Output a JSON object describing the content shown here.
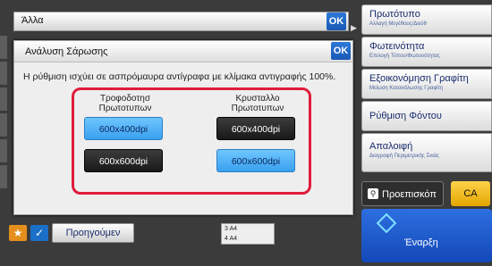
{
  "background": {
    "title": "Άλλα",
    "ok_label": "OK",
    "right_panel": [
      {
        "main": "Πρωτότυπο",
        "sub": "Αλλαγή Μεγέθους/Διεύθ"
      },
      {
        "main": "Φωτεινότητα",
        "sub": "Επιλογή Τύπου/Φωτεινότητας"
      },
      {
        "main": "Εξοικονόμηση Γραφίτη",
        "sub": "Μείωση Κατανάλωσης Γραφίτη"
      },
      {
        "main": "Ρύθμιση Φόντου",
        "sub": ""
      },
      {
        "main": "Απαλοιφή",
        "sub": "Διαγραφή Περιμετρικής Σκιάς"
      }
    ],
    "preview_label": "Προεπισκόπ",
    "ca_label": "CA",
    "start_label": "Έναρξη",
    "prev_label": "Προηγούμεν",
    "tray_rows": [
      "3      A4",
      "4      A4"
    ]
  },
  "dialog": {
    "title": "Ανάλυση Σάρωσης",
    "ok_label": "OK",
    "description": "Η ρύθμιση ισχύει σε ασπρόμαυρα αντίγραφα με κλίμακα αντιγραφής 100%.",
    "columns": [
      {
        "label_line1": "Τροφοδοτησ",
        "label_line2": "Πρωτοτυπων",
        "options": [
          {
            "label": "600x400dpi",
            "selected": true
          },
          {
            "label": "600x600dpi",
            "selected": false
          }
        ]
      },
      {
        "label_line1": "Κρυσταλλο",
        "label_line2": "Πρωτοτυπων",
        "options": [
          {
            "label": "600x400dpi",
            "selected": false
          },
          {
            "label": "600x600dpi",
            "selected": true
          }
        ]
      }
    ]
  },
  "colors": {
    "accent_blue": "#3aa0ef",
    "highlight_red": "#e01c3c",
    "ok_blue": "#1859b5",
    "ca_yellow": "#e2a600"
  }
}
